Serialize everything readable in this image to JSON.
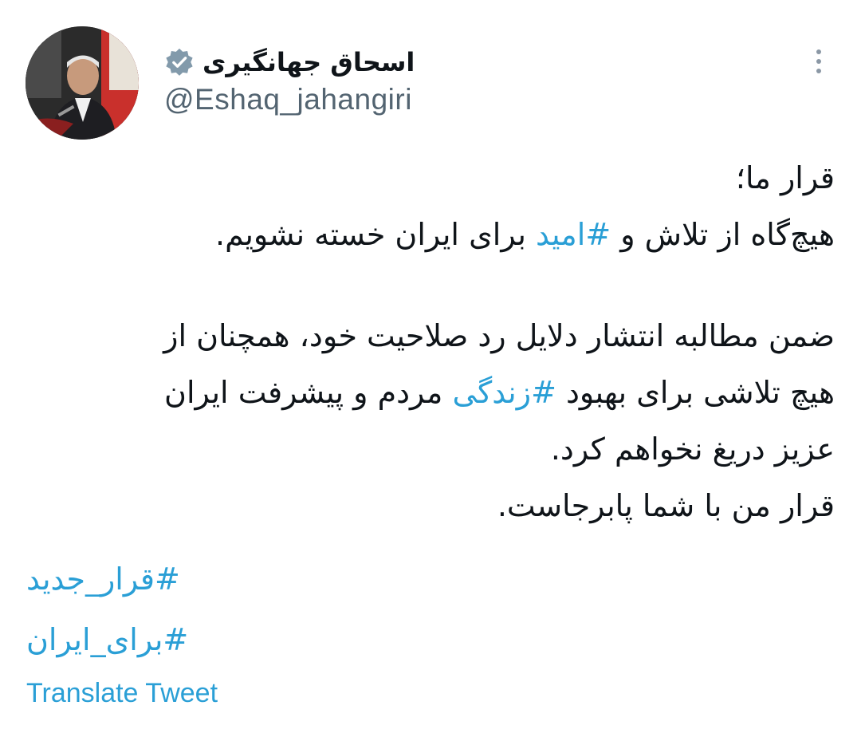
{
  "author": {
    "display_name": "اسحاق جهانگیری",
    "handle": "@Eshaq_jahangiri",
    "verified_icon": "verified-badge-icon",
    "avatar": "avatar-photo"
  },
  "more_icon": "more-vertical-icon",
  "tweet": {
    "line1": "قرار ما؛",
    "line2_before": "هیچ‌گاه از تلاش و ",
    "line2_hashtag": "#امید",
    "line2_after": " برای ایران خسته نشویم.",
    "line3": "ضمن مطالبه انتشار دلایل رد صلاحیت خود، همچنان از",
    "line4_before": "هیچ تلاشی برای بهبود ",
    "line4_hashtag": "#زندگی",
    "line4_after": " مردم و پیشرفت ایران",
    "line5": "عزیز دریغ نخواهم کرد.",
    "line6": "قرار من با شما پابرجاست.",
    "tag1": "#قرار_جدید",
    "tag2": "#برای_ایران"
  },
  "translate_label": "Translate Tweet",
  "colors": {
    "hashtag": "#2a9fd6",
    "text": "#0f1419",
    "secondary": "#536471"
  }
}
